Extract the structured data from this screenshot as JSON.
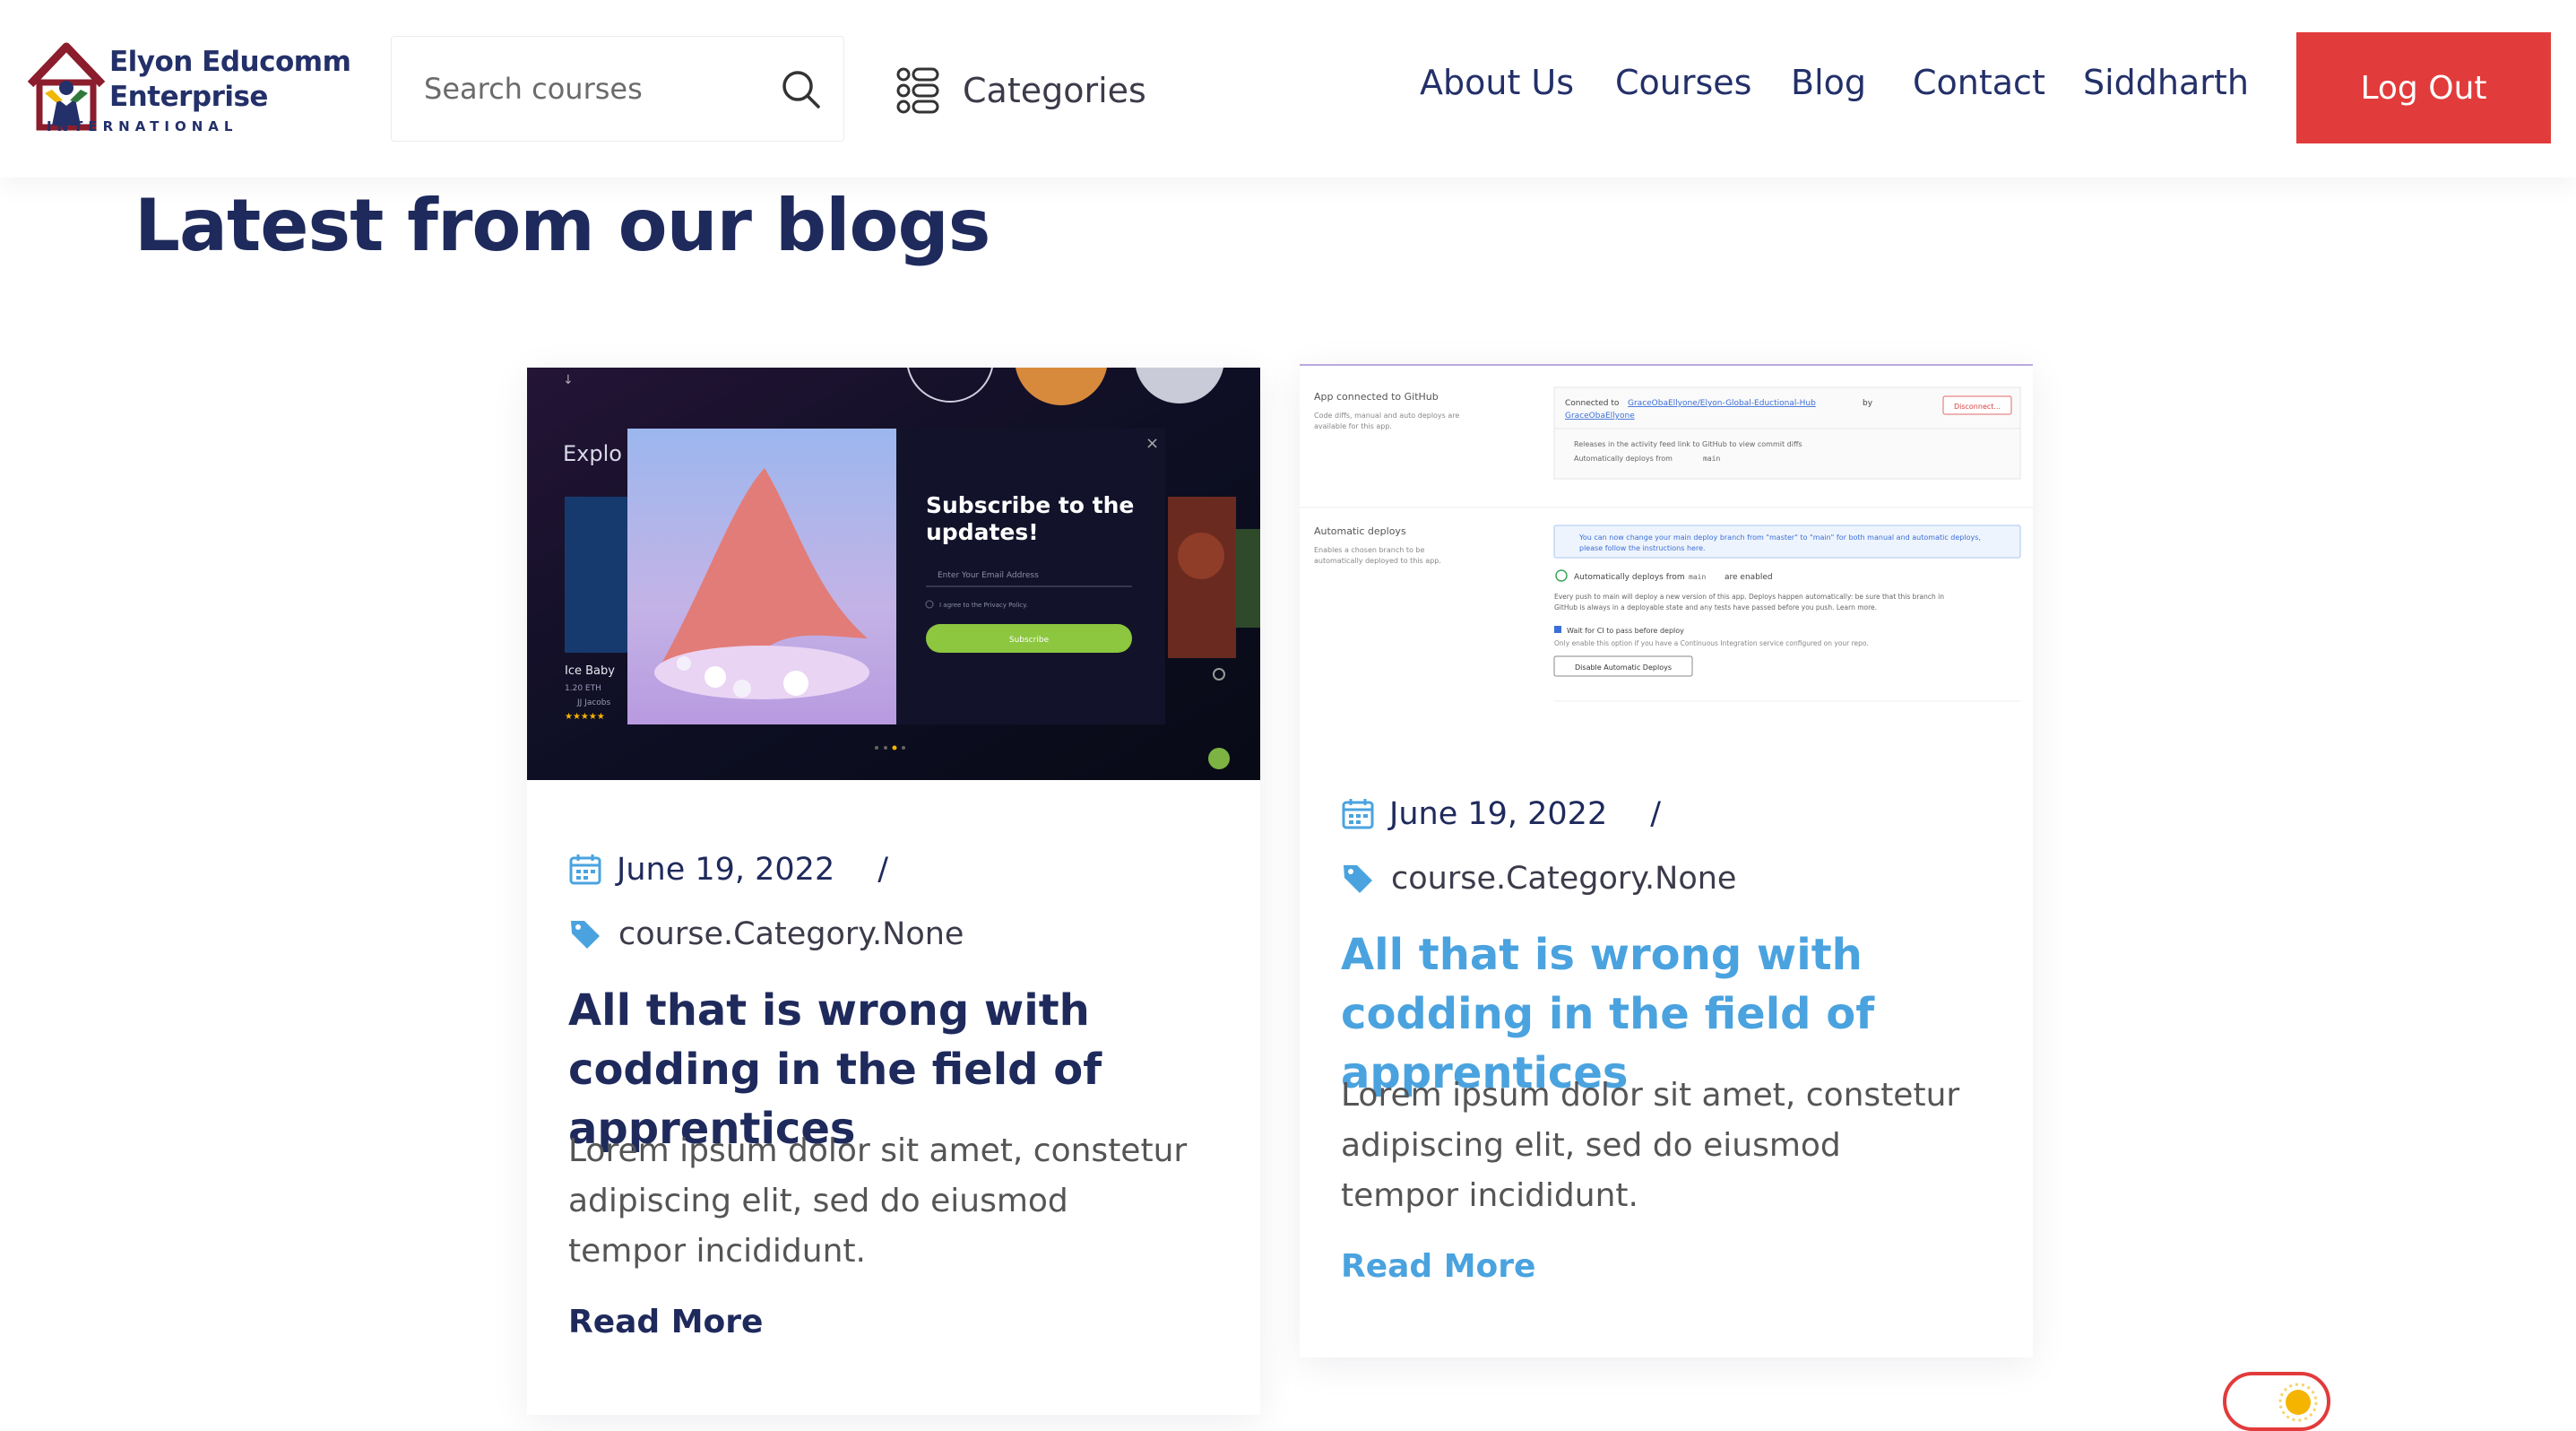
{
  "logo": {
    "name_line1": "Elyon Educomm",
    "name_line2": "Enterprise",
    "sub": "INTERNATIONAL"
  },
  "search": {
    "placeholder": "Search courses"
  },
  "categories": {
    "label": "Categories"
  },
  "nav": [
    "About Us",
    "Courses",
    "Blog",
    "Contact",
    "Siddharth"
  ],
  "logout": {
    "label": "Log Out",
    "color": "#e23b3b"
  },
  "section": {
    "title": "Latest from our blogs"
  },
  "posts": [
    {
      "date": "June 19, 2022",
      "separator": "/",
      "category": "course.Category.None",
      "title": "All that is wrong with codding in the field of apprentices",
      "excerpt": "Lorem ipsum dolor sit amet, constetur adipiscing elit, sed do eiusmod tempor incididunt.",
      "read_more": "Read More",
      "title_color": "#1f2a5c",
      "thumb": {
        "explore": "Explo",
        "subscribe_title": "Subscribe to the updates!",
        "email_placeholder": "Enter Your Email Address",
        "agree": "I agree to the Privacy Policy.",
        "subscribe_btn": "Subscribe",
        "nft_name": "Ice Baby",
        "nft_price": "1.20 ETH",
        "nft_artist": "JJ Jacobs"
      }
    },
    {
      "date": "June 19, 2022",
      "separator": "/",
      "category": "course.Category.None",
      "title": "All that is wrong with codding in the field of apprentices",
      "excerpt": "Lorem ipsum dolor sit amet, constetur adipiscing elit, sed do eiusmod tempor incididunt.",
      "read_more": "Read More",
      "title_color": "#4aa3df",
      "thumb": {
        "app_connected": "App connected to GitHub",
        "app_connected_desc": "Code diffs, manual and auto deploys are available for this app.",
        "connected_to": "Connected to",
        "repo": "GraceObaEllyone/Elyon-Global-Eductional-Hub",
        "by": "by",
        "user": "GraceObaEllyone",
        "disconnect": "Disconnect...",
        "releases": "Releases in the activity feed link to GitHub to view commit diffs",
        "auto_from": "Automatically deploys from",
        "branch": "main",
        "auto_deploys": "Automatic deploys",
        "auto_deploys_desc": "Enables a chosen branch to be automatically deployed to this app.",
        "notice": "You can now change your main deploy branch from \"master\" to \"main\" for both manual and automatic deploys, please follow the instructions here.",
        "enabled": "are enabled",
        "every_push": "Every push to main will deploy a new version of this app. Deploys happen automatically: be sure that this branch in GitHub is always in a deployable state and any tests have passed before you push. Learn more.",
        "wait_ci": "Wait for CI to pass before deploy",
        "wait_ci_desc": "Only enable this option if you have a Continuous Integration service configured on your repo.",
        "disable_btn": "Disable Automatic Deploys"
      }
    }
  ],
  "theme_toggle": {
    "accent": "#e23b3b",
    "sun_color": "#f5b400"
  },
  "colors": {
    "navy": "#1f2a5c",
    "blue": "#4aa3df",
    "red": "#e23b3b"
  }
}
